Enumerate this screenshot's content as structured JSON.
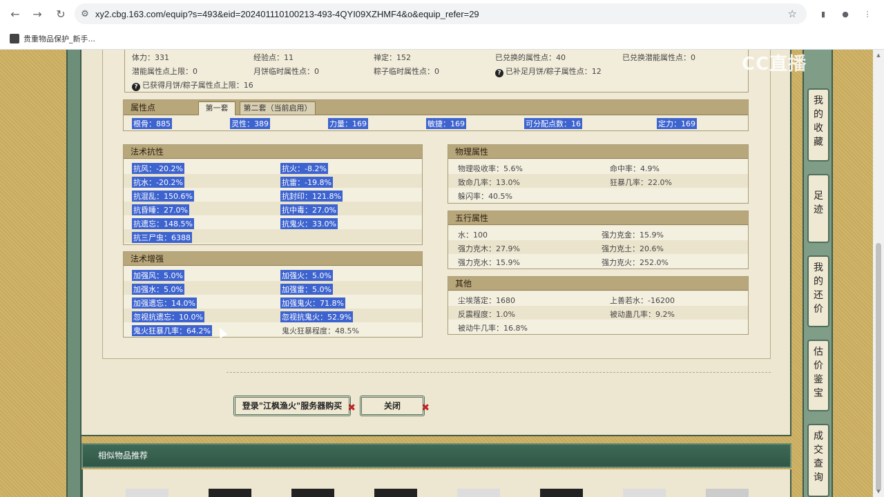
{
  "browser": {
    "url": "xy2.cbg.163.com/equip?s=493&eid=202401110100213-493-4QYI09XZHMF4&o&equip_refer=29",
    "bookmark_label": "贵重物品保护_新手..."
  },
  "overlay_logo": "CC直播",
  "top_stats": {
    "row1": [
      "体力：331",
      "经验点：11",
      "禅定：152",
      "已兑换的属性点：40",
      "已兑换潜能属性点：0"
    ],
    "row2": [
      "潜能属性点上限：0",
      "月饼临时属性点：0",
      "粽子临时属性点：0",
      "已补足月饼/粽子属性点：12"
    ],
    "row3": "已获得月饼/粽子属性点上限：16"
  },
  "attr_points": {
    "title": "属性点",
    "tab1": "第一套",
    "tab2": "第二套（当前启用）",
    "values": [
      "根骨：885",
      "灵性：389",
      "力量：169",
      "敏捷：169",
      "可分配点数：16",
      "定力：169"
    ]
  },
  "resist": {
    "title": "法术抗性",
    "left": [
      "抗风：-20.2%",
      "抗水：-20.2%",
      "抗混乱：150.6%",
      "抗昏睡：27.0%",
      "抗遗忘：148.5%",
      "抗三尸虫：6388"
    ],
    "right": [
      "抗火：-8.2%",
      "抗雷：-19.8%",
      "抗封印：121.8%",
      "抗中毒：27.0%",
      "抗鬼火：33.0%"
    ]
  },
  "enhance": {
    "title": "法术增强",
    "left": [
      "加强风：5.0%",
      "加强水：5.0%",
      "加强遗忘：14.0%",
      "忽视抗遗忘：10.0%",
      "鬼火狂暴几率：64.2%"
    ],
    "right": [
      "加强火：5.0%",
      "加强雷：5.0%",
      "加强鬼火：71.8%",
      "忽视抗鬼火：52.9%",
      "鬼火狂暴程度：48.5%"
    ]
  },
  "physical": {
    "title": "物理属性",
    "left": [
      "物理吸收率：5.6%",
      "致命几率：13.0%",
      "躲闪率：40.5%"
    ],
    "right": [
      "命中率：4.9%",
      "狂暴几率：22.0%"
    ]
  },
  "elements": {
    "title": "五行属性",
    "left": [
      "水：100",
      "强力克木：27.9%",
      "强力克水：15.9%"
    ],
    "right": [
      "强力克金：15.9%",
      "强力克土：20.6%",
      "强力克火：252.0%"
    ]
  },
  "other": {
    "title": "其他",
    "left": [
      "尘埃落定：1680",
      "反震程度：1.0%",
      "被动牛几率：16.8%"
    ],
    "right": [
      "上善若水：-16200",
      "被动蛊几率：9.2%"
    ]
  },
  "buttons": {
    "login_buy": "登录\"江枫渔火\"服务器购买",
    "close": "关闭"
  },
  "recommend_title": "相似物品推荐",
  "side_menu": [
    "我的收藏",
    "足迹",
    "我的还价",
    "估价鉴宝",
    "成交查询"
  ]
}
